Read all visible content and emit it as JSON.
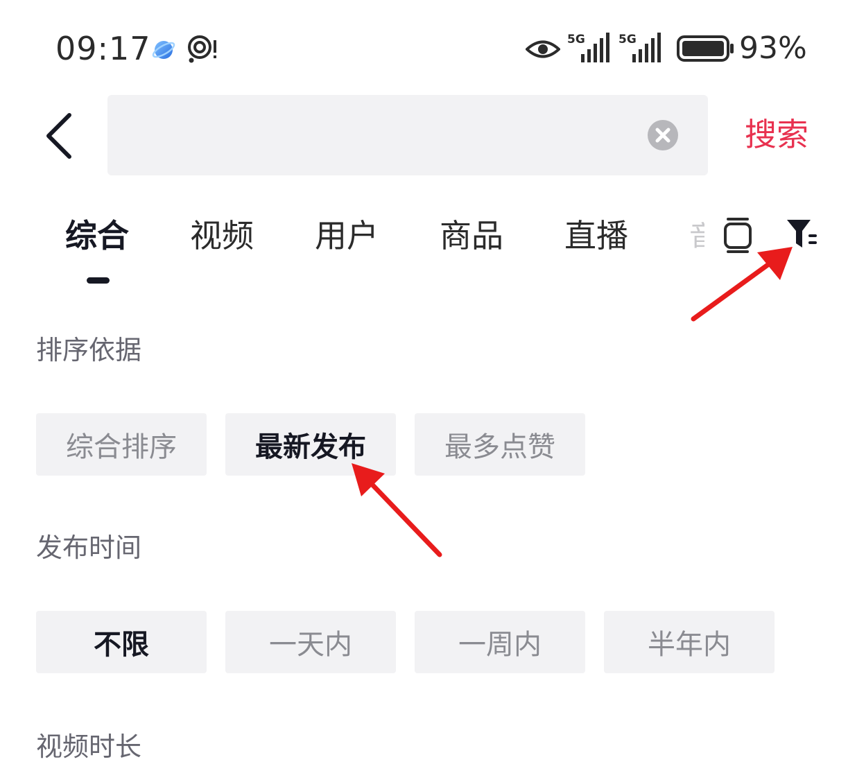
{
  "status_bar": {
    "time": "09:17",
    "battery": "93%",
    "network_1": "5G",
    "network_2": "5G",
    "icons": [
      "planet-icon",
      "notification-icon",
      "eye-icon",
      "signal-icon",
      "signal-icon",
      "battery-icon"
    ]
  },
  "header": {
    "search_placeholder": "",
    "search_value": "",
    "search_button": "搜索",
    "accent_color": "#e8314f"
  },
  "tabs": [
    {
      "label": "综合",
      "active": true
    },
    {
      "label": "视频",
      "active": false
    },
    {
      "label": "用户",
      "active": false
    },
    {
      "label": "商品",
      "active": false
    },
    {
      "label": "直播",
      "active": false
    }
  ],
  "tab_partial": "音",
  "filters": {
    "sort": {
      "title": "排序依据",
      "options": [
        {
          "label": "综合排序",
          "selected": false
        },
        {
          "label": "最新发布",
          "selected": true
        },
        {
          "label": "最多点赞",
          "selected": false
        }
      ]
    },
    "time": {
      "title": "发布时间",
      "options": [
        {
          "label": "不限",
          "selected": true
        },
        {
          "label": "一天内",
          "selected": false
        },
        {
          "label": "一周内",
          "selected": false
        },
        {
          "label": "半年内",
          "selected": false
        }
      ]
    },
    "duration": {
      "title": "视频时长"
    }
  },
  "annotation_color": "#e81c1c"
}
